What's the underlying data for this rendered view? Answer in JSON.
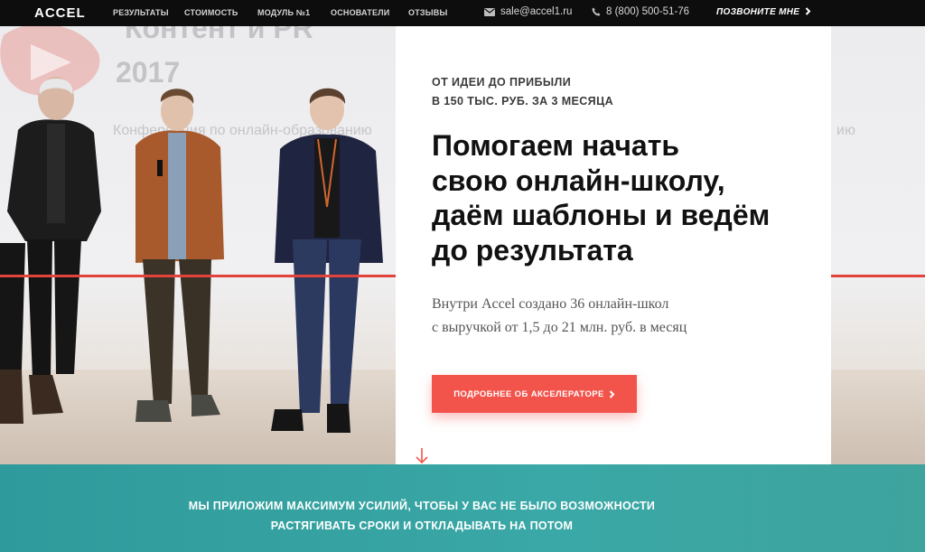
{
  "header": {
    "logo": "ACCEL",
    "nav": [
      "РЕЗУЛЬТАТЫ",
      "СТОИМОСТЬ",
      "МОДУЛЬ №1",
      "ОСНОВАТЕЛИ",
      "ОТЗЫВЫ"
    ],
    "email": "sale@accel1.ru",
    "phone": "8 (800) 500-51-76",
    "callback": "ПОЗВОНИТЕ МНЕ"
  },
  "hero": {
    "backdrop": {
      "line1": "Контент и PR",
      "line2": "2017",
      "line3": "Конференция по онлайн-образованию",
      "line3_tail": "ию"
    },
    "kicker_line1": "ОТ ИДЕИ ДО ПРИБЫЛИ",
    "kicker_line2": "В 150 ТЫС. РУБ. ЗА 3 МЕСЯЦА",
    "headline": [
      "Помогаем начать",
      "свою онлайн-школу,",
      "даём шаблоны и ведём",
      "до результата"
    ],
    "subtext": [
      "Внутри Accel создано 36 онлайн-школ",
      "с выручкой от 1,5 до 21 млн. руб. в месяц"
    ],
    "cta": "ПОДРОБНЕЕ ОБ АКСЕЛЕРАТОРЕ"
  },
  "band": {
    "line1": "МЫ ПРИЛОЖИМ МАКСИМУМ УСИЛИЙ, ЧТОБЫ У ВАС НЕ БЫЛО ВОЗМОЖНОСТИ",
    "line2": "РАСТЯГИВАТЬ СРОКИ И ОТКЛАДЫВАТЬ НА ПОТОМ"
  },
  "colors": {
    "accent": "#f2544b",
    "band": "#36a3a2",
    "topbar": "#0d0d0d"
  },
  "icons": {
    "email": "envelope-icon",
    "phone": "phone-icon",
    "callback": "chevron-right-icon",
    "scroll": "arrow-down-icon"
  }
}
